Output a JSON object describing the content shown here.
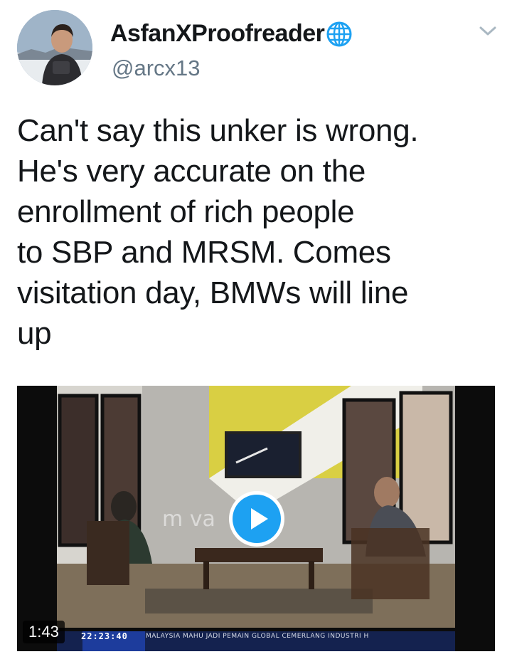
{
  "user": {
    "display_name": "AsfanXProofreader",
    "handle": "@arcx13"
  },
  "tweet": {
    "text": "Can't say this unker is wrong.\nHe's very accurate on the\nenrollment of rich people\nto SBP and MRSM. Comes\nvisitation day, BMWs will line\nup"
  },
  "video": {
    "duration": "1:43",
    "ticker_time": "22:23:40",
    "ticker_text": "MALAYSIA MAHU JADI PEMAIN GLOBAL CEMERLANG INDUSTRI H",
    "watermark": "m  va"
  },
  "icons": {
    "verified_globe": "globe-icon",
    "menu_caret": "chevron-down-icon",
    "play": "play-icon"
  },
  "colors": {
    "accent": "#1da1f2",
    "text": "#14171a",
    "muted": "#657786"
  }
}
